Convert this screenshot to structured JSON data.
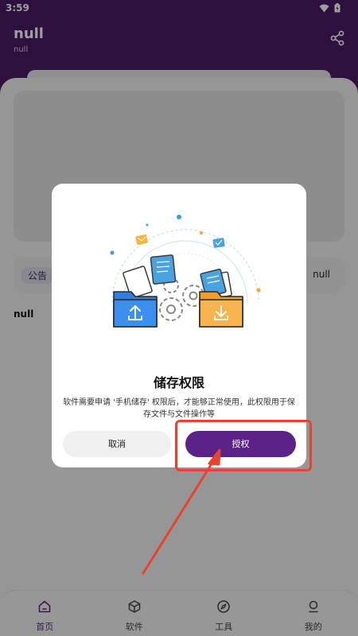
{
  "status_bar": {
    "time": "3:59"
  },
  "header": {
    "title": "null",
    "subtitle": "null"
  },
  "notice": {
    "tag": "公告",
    "right_text": "null"
  },
  "section": {
    "title": "null"
  },
  "dialog": {
    "title": "储存权限",
    "description": "软件需要申请 '手机储存' 权限后，才能够正常使用，此权限用于保存文件与文件操作等",
    "cancel_label": "取消",
    "grant_label": "授权"
  },
  "bottom_nav": {
    "items": [
      {
        "label": "首页",
        "icon": "home-icon",
        "active": true
      },
      {
        "label": "软件",
        "icon": "cube-icon",
        "active": false
      },
      {
        "label": "工具",
        "icon": "compass-icon",
        "active": false
      },
      {
        "label": "我的",
        "icon": "user-icon",
        "active": false
      }
    ]
  },
  "colors": {
    "primary": "#4a1b63",
    "button": "#5b2388",
    "annotation": "#e8432e"
  }
}
